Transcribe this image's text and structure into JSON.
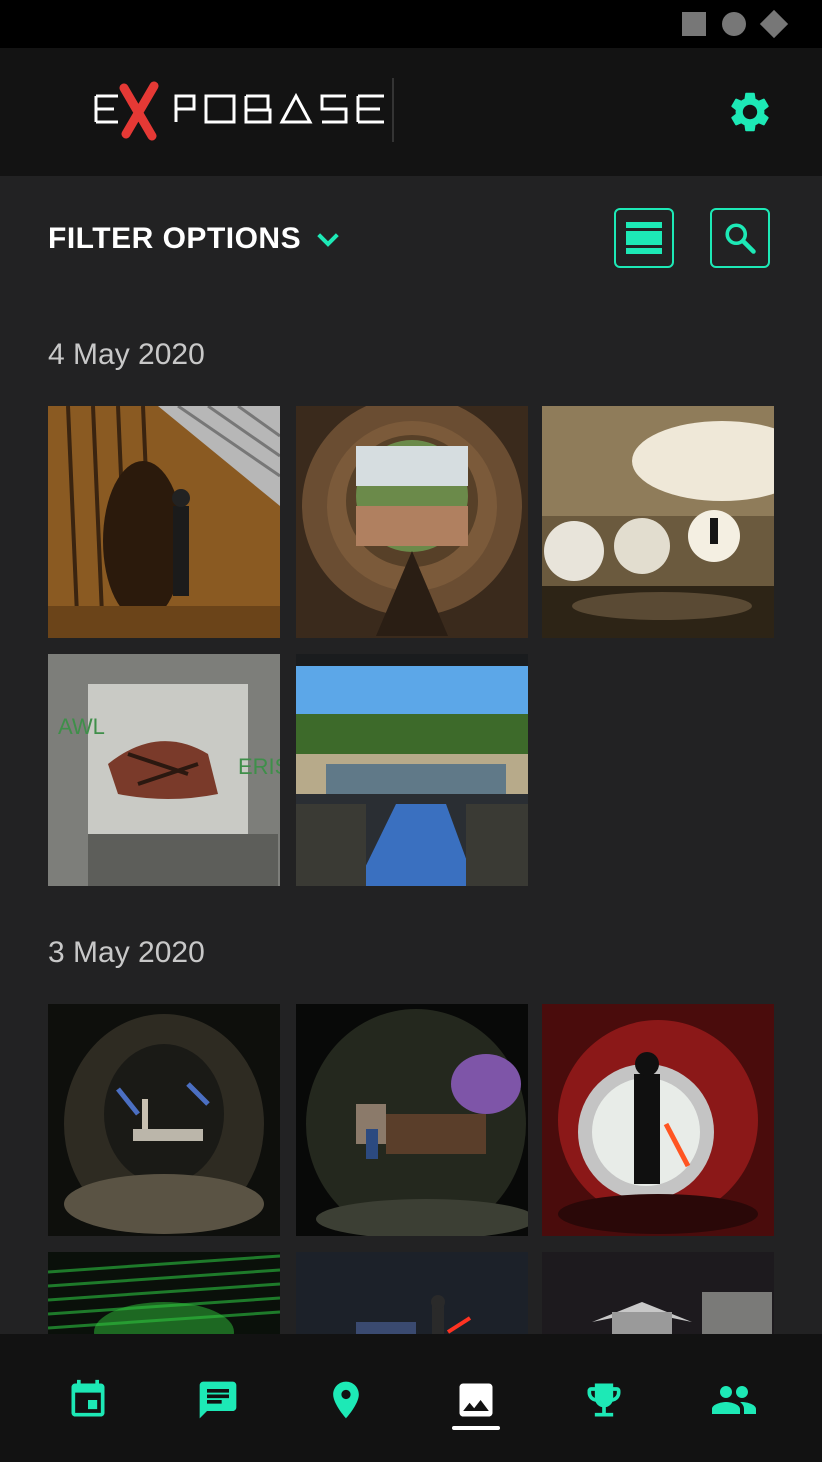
{
  "app": {
    "brand": "EXPOBASE"
  },
  "toolbar": {
    "filter_label": "FILTER OPTIONS"
  },
  "sections": [
    {
      "date": "4 May 2020",
      "photos": [
        {
          "alt": "person leaning on wall under striped stair shadows"
        },
        {
          "alt": "concrete pipe opening to grassland"
        },
        {
          "alt": "underground chamber with round windows and silhouettes"
        },
        {
          "alt": "graffiti of a creature in concrete box"
        },
        {
          "alt": "flooded spillway under blue sky"
        }
      ]
    },
    {
      "date": "3 May 2020",
      "photos": [
        {
          "alt": "brick tunnel with figures and debris"
        },
        {
          "alt": "person with rusted machinery in dark tunnel"
        },
        {
          "alt": "silhouette with red lightsaber in tunnel exit"
        },
        {
          "alt": "green lit corrugated surface"
        },
        {
          "alt": "night scene with figure and red light"
        },
        {
          "alt": "night structure and trucks"
        }
      ]
    }
  ],
  "nav": {
    "items": [
      "calendar-icon",
      "chat-icon",
      "location-icon",
      "gallery-icon",
      "trophy-icon",
      "people-icon"
    ],
    "active": "gallery-icon"
  },
  "colors": {
    "accent": "#1de9b6",
    "background": "#222223",
    "header": "#131313"
  }
}
